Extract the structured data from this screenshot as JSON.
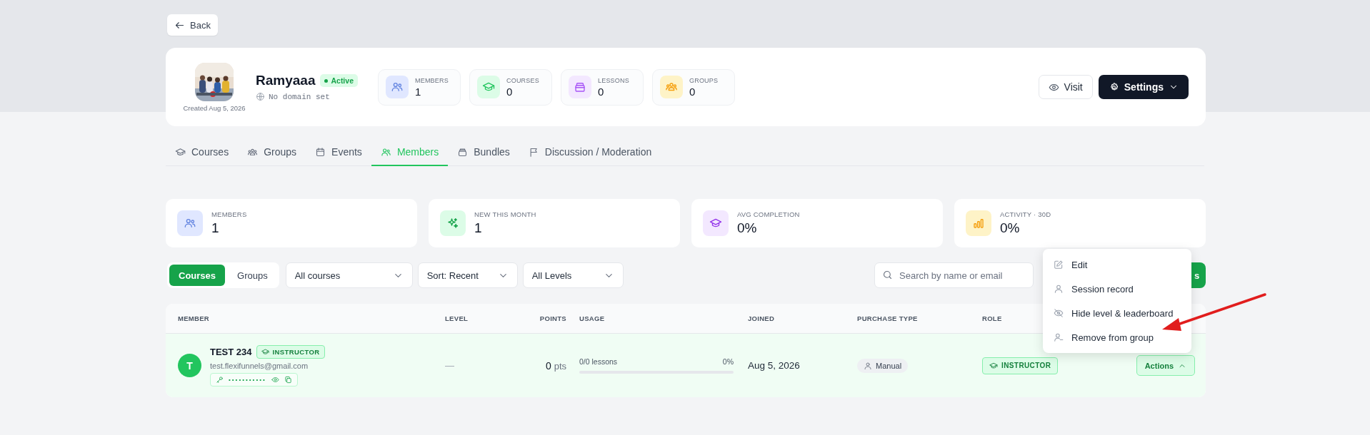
{
  "back_button": {
    "label": "Back"
  },
  "group": {
    "name": "Ramyaaa",
    "status": "Active",
    "domain": "No domain set",
    "created": "Created Aug 5, 2026"
  },
  "header_stats": [
    {
      "kind": "members",
      "label": "MEMBERS",
      "value": "1"
    },
    {
      "kind": "courses",
      "label": "COURSES",
      "value": "0"
    },
    {
      "kind": "lessons",
      "label": "LESSONS",
      "value": "0"
    },
    {
      "kind": "groups",
      "label": "GROUPS",
      "value": "0"
    }
  ],
  "header_actions": {
    "visit": "Visit",
    "settings": "Settings"
  },
  "tabs": [
    {
      "kind": "courses",
      "label": "Courses",
      "selected": false
    },
    {
      "kind": "groups",
      "label": "Groups",
      "selected": false
    },
    {
      "kind": "events",
      "label": "Events",
      "selected": false
    },
    {
      "kind": "members",
      "label": "Members",
      "selected": true
    },
    {
      "kind": "bundles",
      "label": "Bundles",
      "selected": false
    },
    {
      "kind": "discussion",
      "label": "Discussion / Moderation",
      "selected": false
    }
  ],
  "summary_cards": [
    {
      "kind": "members",
      "label": "MEMBERS",
      "value": "1"
    },
    {
      "kind": "new",
      "label": "NEW THIS MONTH",
      "value": "1"
    },
    {
      "kind": "completion",
      "label": "AVG COMPLETION",
      "value": "0%"
    },
    {
      "kind": "activity",
      "label": "ACTIVITY · 30D",
      "value": "0%"
    }
  ],
  "filters": {
    "view_toggle": [
      {
        "label": "Courses",
        "selected": true
      },
      {
        "label": "Groups",
        "selected": false
      }
    ],
    "dropdowns": [
      {
        "value": "All courses"
      },
      {
        "value": "Sort: Recent"
      },
      {
        "value": "All Levels"
      }
    ],
    "search": {
      "placeholder": "Search by name or email"
    },
    "primary_button": {
      "label": "s"
    }
  },
  "table": {
    "columns": [
      "MEMBER",
      "LEVEL",
      "POINTS",
      "USAGE",
      "JOINED",
      "PURCHASE TYPE",
      "ROLE"
    ],
    "rows": [
      {
        "initial": "T",
        "name": "TEST 234",
        "badge": "INSTRUCTOR",
        "email": "test.flexifunnels@gmail.com",
        "password": "•••••••••••",
        "level_value": "—",
        "points": "0",
        "points_unit": "pts",
        "usage": {
          "label": "0/0 lessons",
          "reading": "0%",
          "level": 0
        },
        "joined": "Aug 5, 2026",
        "purchase_type": "Manual",
        "role": "INSTRUCTOR",
        "actions": {
          "label": "Actions",
          "expanded": true
        }
      }
    ]
  },
  "action_menu": {
    "items": [
      {
        "kind": "edit",
        "label": "Edit"
      },
      {
        "kind": "record",
        "label": "Session record"
      },
      {
        "kind": "hide",
        "label": "Hide level & leaderboard"
      },
      {
        "kind": "remove",
        "label": "Remove from group"
      }
    ]
  }
}
